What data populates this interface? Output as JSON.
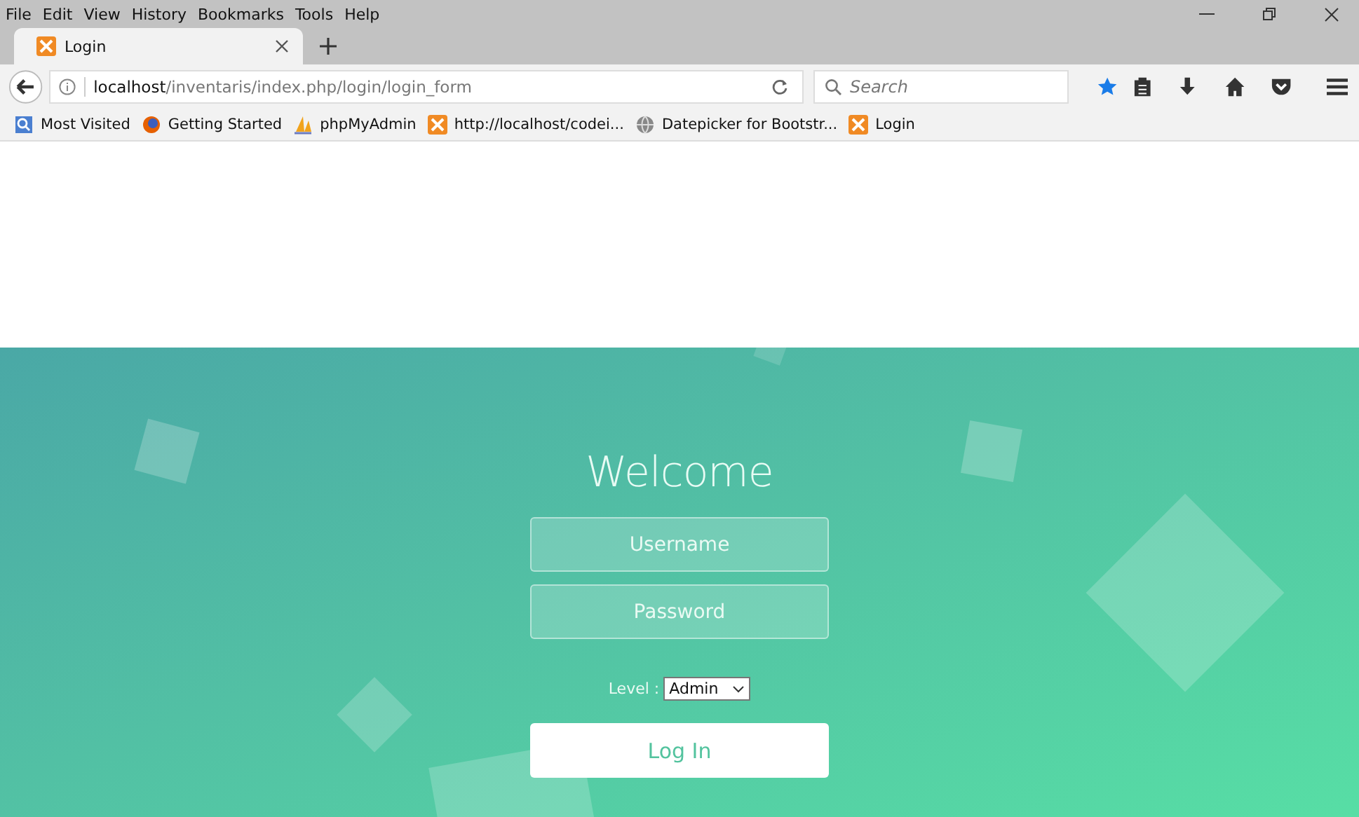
{
  "menu_bar": [
    "File",
    "Edit",
    "View",
    "History",
    "Bookmarks",
    "Tools",
    "Help"
  ],
  "tabs": [
    {
      "title": "Login",
      "selected": true
    }
  ],
  "address_bar": {
    "host": "localhost",
    "path": "/inventaris/index.php/login/login_form"
  },
  "search": {
    "placeholder": "Search"
  },
  "bookmarks": [
    {
      "label": "Most Visited",
      "kind": "folder"
    },
    {
      "label": "Getting Started",
      "kind": "firefox"
    },
    {
      "label": "phpMyAdmin",
      "kind": "pma"
    },
    {
      "label": "http://localhost/codei...",
      "kind": "xampp"
    },
    {
      "label": "Datepicker for Bootstr...",
      "kind": "globe"
    },
    {
      "label": "Login",
      "kind": "xampp"
    }
  ],
  "login": {
    "title": "Welcome",
    "username": {
      "placeholder": "Username"
    },
    "password": {
      "placeholder": "Password"
    },
    "level_label": "Level :",
    "level_value": "Admin",
    "button": "Log In"
  }
}
